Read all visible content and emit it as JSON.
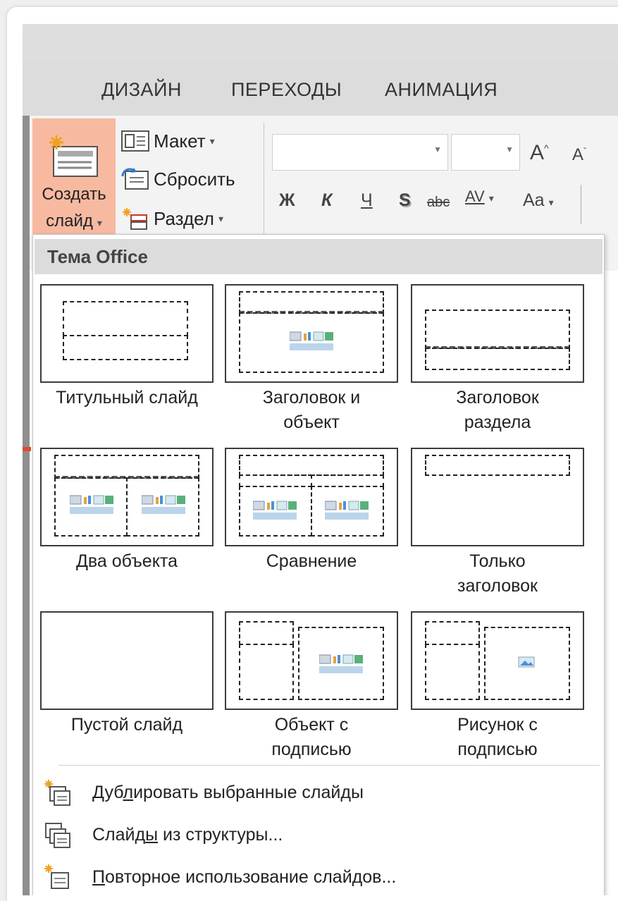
{
  "tabs": [
    "ДИЗАЙН",
    "ПЕРЕХОДЫ",
    "АНИМАЦИЯ"
  ],
  "ribbon": {
    "new_slide_line1": "Создать",
    "new_slide_line2": "слайд",
    "layout": "Макет",
    "reset": "Сбросить",
    "section": "Раздел",
    "font_grow": "A",
    "font_shrink": "A",
    "bold": "Ж",
    "italic": "К",
    "underline": "Ч",
    "shadow": "S",
    "strike": "abc",
    "spacing": "AV",
    "case": "Aa"
  },
  "menu": {
    "header": "Тема Office",
    "layouts": [
      {
        "line1": "Титульный слайд",
        "line2": ""
      },
      {
        "line1": "Заголовок и",
        "line2": "объект"
      },
      {
        "line1": "Заголовок",
        "line2": "раздела"
      },
      {
        "line1": "Два объекта",
        "line2": ""
      },
      {
        "line1": "Сравнение",
        "line2": ""
      },
      {
        "line1": "Только",
        "line2": "заголовок"
      },
      {
        "line1": "Пустой слайд",
        "line2": ""
      },
      {
        "line1": "Объект с",
        "line2": "подписью"
      },
      {
        "line1": "Рисунок с",
        "line2": "подписью"
      }
    ],
    "commands": [
      {
        "pre": "Дуб",
        "u": "л",
        "post": "ировать выбранные слайды"
      },
      {
        "pre": "Слайд",
        "u": "ы",
        "post": " из структуры..."
      },
      {
        "pre": "",
        "u": "П",
        "post": "овторное использование слайдов..."
      }
    ]
  },
  "colors": {
    "accent_button": "#f8b9a1",
    "header_bg": "#dcdcdc"
  }
}
